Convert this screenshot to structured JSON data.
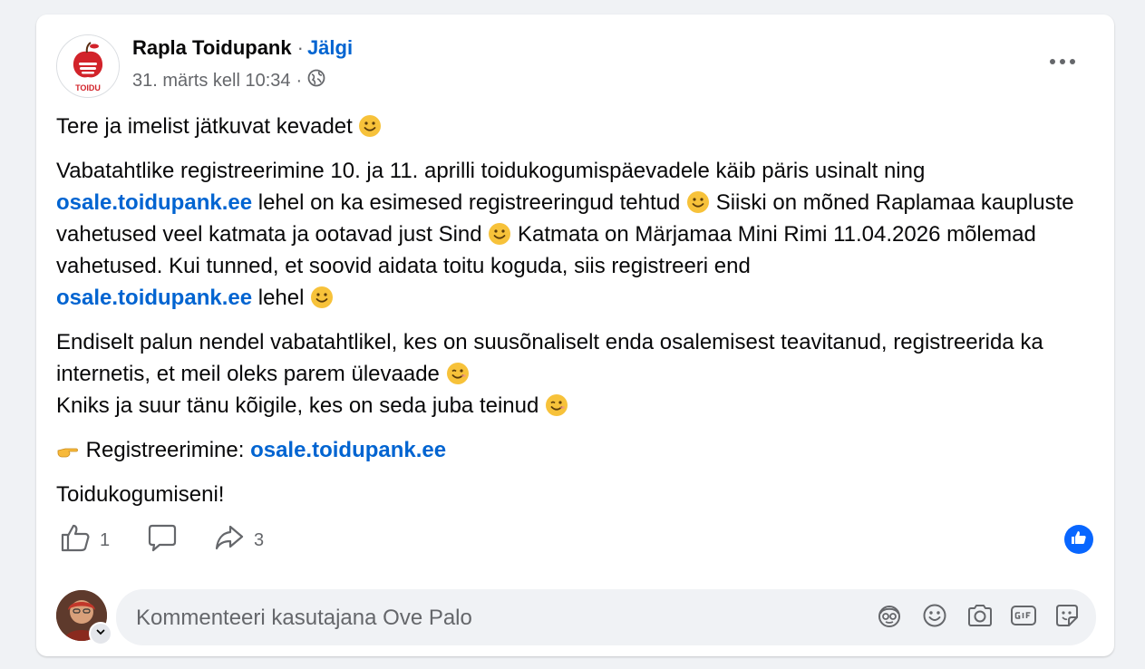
{
  "post": {
    "author": "Rapla Toidupank",
    "separator": "·",
    "follow_label": "Jälgi",
    "timestamp": "31. märts kell 10:34",
    "meta_dot": "·",
    "logo_text": "TOIDU",
    "paragraphs": {
      "p1": "Tere ja imelist jätkuvat kevadet",
      "p2a": "Vabatahtlike registreerimine 10. ja 11. aprilli toidukogumispäevadele käib päris usinalt ning",
      "link": "osale.toidupank.ee",
      "p2b": " lehel on ka esimesed registreeringud tehtud",
      "p2c": " Siiski on mõned Raplamaa kaupluste vahetused  veel katmata ja ootavad just Sind",
      "p2d": " Katmata on Märjamaa Mini Rimi 11.04.2026 mõlemad vahetused. Kui tunned, et soovid aidata toitu koguda, siis registreeri end",
      "p2e": " lehel",
      "p3a": "Endiselt palun nendel vabatahtlikel, kes on suusõnaliselt enda osalemisest teavitanud, registreerida ka internetis, et meil oleks parem ülevaade",
      "p3b": "Kniks ja suur tänu kõigile, kes on seda juba teinud",
      "p4": " Registreerimine: ",
      "p5": "Toidukogumiseni!"
    }
  },
  "actions": {
    "like_count": "1",
    "share_count": "3"
  },
  "comment": {
    "placeholder": "Kommenteeri kasutajana Ove Palo"
  },
  "icons": {
    "more": "more-dots-icon",
    "globe": "globe-icon",
    "like": "thumbs-up-icon",
    "comment": "comment-bubble-icon",
    "share": "share-arrow-icon",
    "avatar_sticker": "avatar-sticker-icon",
    "emoji": "smiley-icon",
    "camera": "camera-icon",
    "gif": "gif-icon",
    "sticker": "sticker-icon"
  },
  "colors": {
    "link": "#0064d1",
    "like_badge": "#0866ff",
    "background": "#f0f2f5"
  }
}
